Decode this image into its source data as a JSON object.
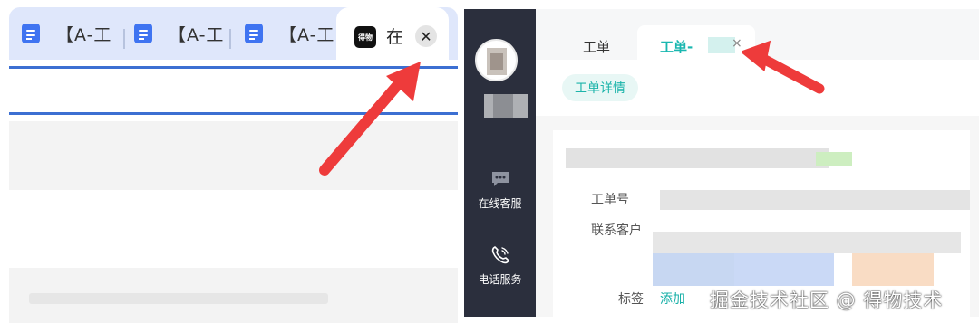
{
  "browser": {
    "tabs": [
      {
        "icon": "doc-icon",
        "label": "【A-工"
      },
      {
        "icon": "doc-icon",
        "label": "【A-工"
      },
      {
        "icon": "doc-icon",
        "label": "【A-工"
      }
    ],
    "active_tab": {
      "icon": "dewu-app-icon",
      "icon_text": "得物",
      "label": "在",
      "close_glyph": "✕"
    }
  },
  "service": {
    "sidebar": {
      "items": [
        {
          "icon": "chat-icon",
          "label": "在线客服"
        },
        {
          "icon": "phone-icon",
          "label": "电话服务"
        }
      ]
    },
    "tabs": {
      "work_label": "工单",
      "active_label": "工单-",
      "active_close": "×"
    },
    "detail_pill": "工单详情",
    "fields": {
      "ticket_no": "工单号",
      "contact": "联系客户",
      "tags": "标签",
      "tags_add": "添加"
    },
    "accent_color": "#19b7b0"
  },
  "annotations": {
    "arrow_color": "#ee3b3b"
  },
  "watermark": "掘金技术社区 @ 得物技术"
}
